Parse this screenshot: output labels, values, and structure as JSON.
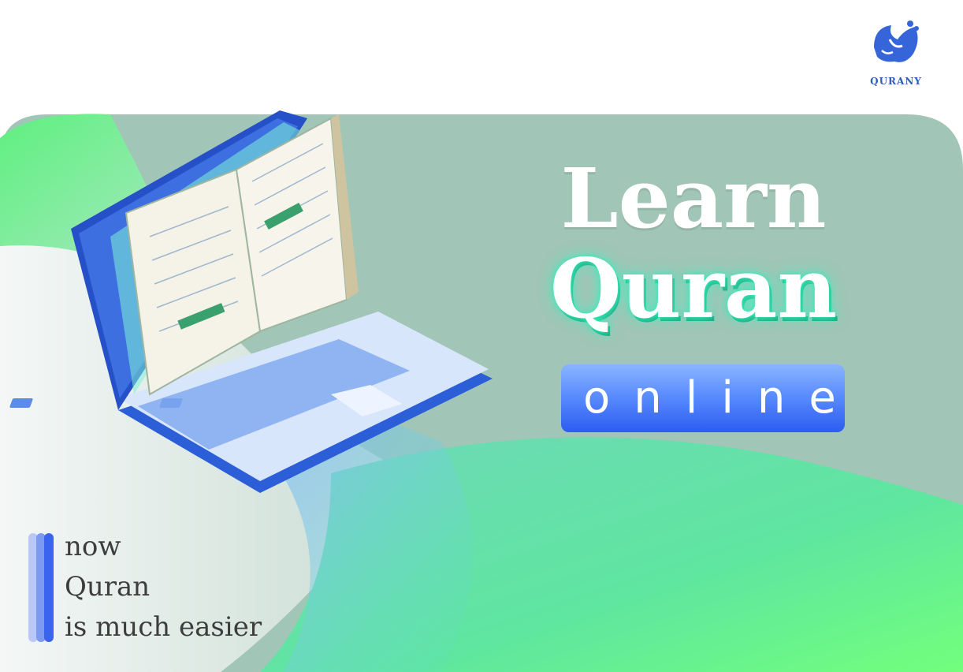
{
  "logo": {
    "name": "QURANY",
    "icon": "qurany-calligraphy-logo",
    "color": "#2d5fb8"
  },
  "headline": {
    "line1": "Learn",
    "line2": "Quran",
    "line3": "online"
  },
  "tagline": {
    "line1": "now",
    "line2": "Quran",
    "line3": "is much easier"
  },
  "illustration": {
    "subject": "laptop-with-open-quran-icon"
  },
  "colors": {
    "panel": "#a1c5b6",
    "accent_green": "#6ef58a",
    "accent_blue": "#3a64ee",
    "text_dark": "#3d3d3d"
  }
}
